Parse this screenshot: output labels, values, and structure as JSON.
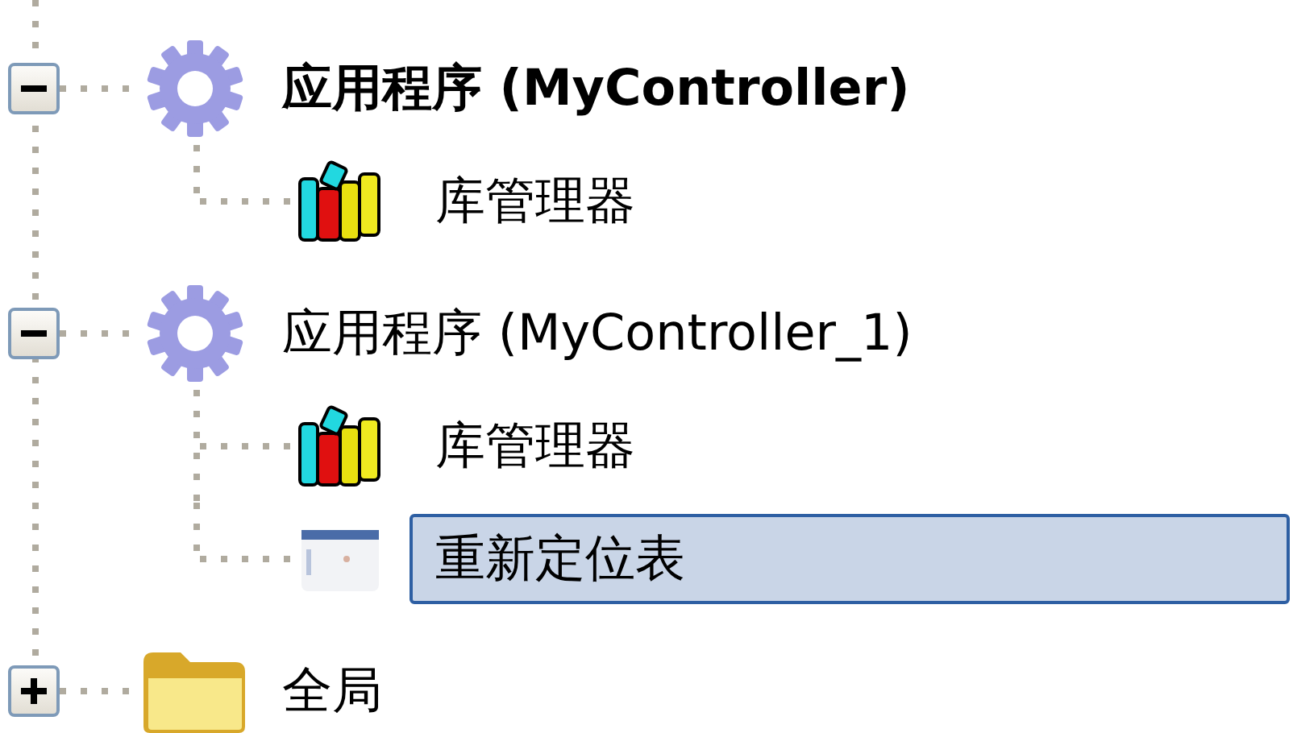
{
  "tree": [
    {
      "kind": "application",
      "label": "应用程序 (MyController)",
      "bold": true,
      "expanded": true,
      "children": [
        {
          "kind": "library",
          "label": "库管理器",
          "selected": false
        }
      ]
    },
    {
      "kind": "application",
      "label": "应用程序 (MyController_1)",
      "bold": false,
      "expanded": true,
      "children": [
        {
          "kind": "library",
          "label": "库管理器",
          "selected": false
        },
        {
          "kind": "relocation",
          "label": "重新定位表",
          "selected": true
        }
      ]
    },
    {
      "kind": "folder",
      "label": "全局",
      "expanded": false
    }
  ]
}
